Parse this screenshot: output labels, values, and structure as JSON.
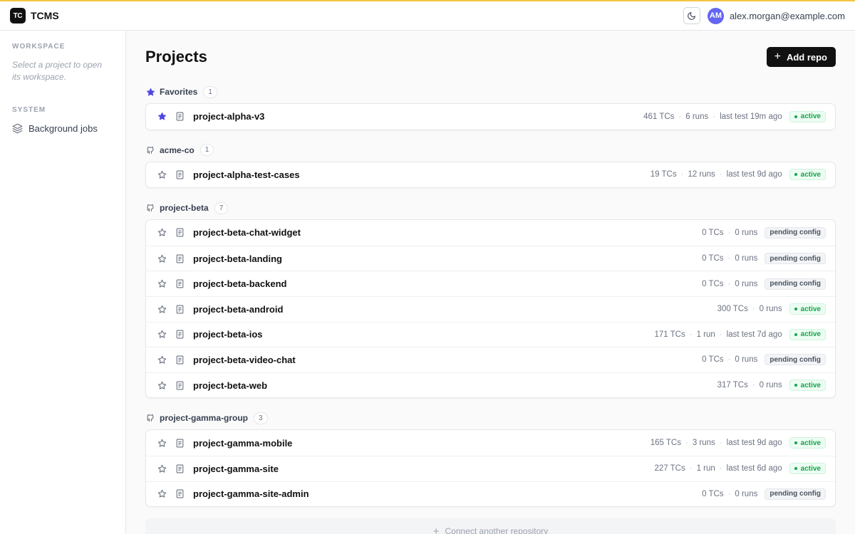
{
  "app": {
    "logo": "TC",
    "name": "TCMS"
  },
  "user": {
    "initials": "AM",
    "email": "alex.morgan@example.com"
  },
  "sidebar": {
    "workspace_heading": "WORKSPACE",
    "workspace_hint": "Select a project to open its workspace.",
    "system_heading": "SYSTEM",
    "items": [
      {
        "label": "Background jobs",
        "icon": "layers-icon"
      }
    ]
  },
  "page": {
    "title": "Projects",
    "add_label": "Add repo",
    "connect_label": "Connect another repository"
  },
  "colors": {
    "accent_bar": "#f5c542",
    "favorite_star": "#4f46e5",
    "active": "#16a34a",
    "avatar": "#6366f1"
  },
  "groups": [
    {
      "name": "Favorites",
      "count": "1",
      "icon": "star-icon",
      "projects": [
        {
          "name": "project-alpha-v3",
          "favorite": true,
          "tcs": "461 TCs",
          "runs": "6 runs",
          "last": "last test 19m ago",
          "status": "active"
        }
      ]
    },
    {
      "name": "acme-co",
      "count": "1",
      "icon": "github-icon",
      "projects": [
        {
          "name": "project-alpha-test-cases",
          "favorite": false,
          "tcs": "19 TCs",
          "runs": "12 runs",
          "last": "last test 9d ago",
          "status": "active"
        }
      ]
    },
    {
      "name": "project-beta",
      "count": "7",
      "icon": "github-icon",
      "projects": [
        {
          "name": "project-beta-chat-widget",
          "favorite": false,
          "tcs": "0 TCs",
          "runs": "0 runs",
          "last": "",
          "status": "pending config"
        },
        {
          "name": "project-beta-landing",
          "favorite": false,
          "tcs": "0 TCs",
          "runs": "0 runs",
          "last": "",
          "status": "pending config"
        },
        {
          "name": "project-beta-backend",
          "favorite": false,
          "tcs": "0 TCs",
          "runs": "0 runs",
          "last": "",
          "status": "pending config"
        },
        {
          "name": "project-beta-android",
          "favorite": false,
          "tcs": "300 TCs",
          "runs": "0 runs",
          "last": "",
          "status": "active"
        },
        {
          "name": "project-beta-ios",
          "favorite": false,
          "tcs": "171 TCs",
          "runs": "1 run",
          "last": "last test 7d ago",
          "status": "active"
        },
        {
          "name": "project-beta-video-chat",
          "favorite": false,
          "tcs": "0 TCs",
          "runs": "0 runs",
          "last": "",
          "status": "pending config"
        },
        {
          "name": "project-beta-web",
          "favorite": false,
          "tcs": "317 TCs",
          "runs": "0 runs",
          "last": "",
          "status": "active"
        }
      ]
    },
    {
      "name": "project-gamma-group",
      "count": "3",
      "icon": "github-icon",
      "projects": [
        {
          "name": "project-gamma-mobile",
          "favorite": false,
          "tcs": "165 TCs",
          "runs": "3 runs",
          "last": "last test 9d ago",
          "status": "active"
        },
        {
          "name": "project-gamma-site",
          "favorite": false,
          "tcs": "227 TCs",
          "runs": "1 run",
          "last": "last test 6d ago",
          "status": "active"
        },
        {
          "name": "project-gamma-site-admin",
          "favorite": false,
          "tcs": "0 TCs",
          "runs": "0 runs",
          "last": "",
          "status": "pending config"
        }
      ]
    }
  ]
}
